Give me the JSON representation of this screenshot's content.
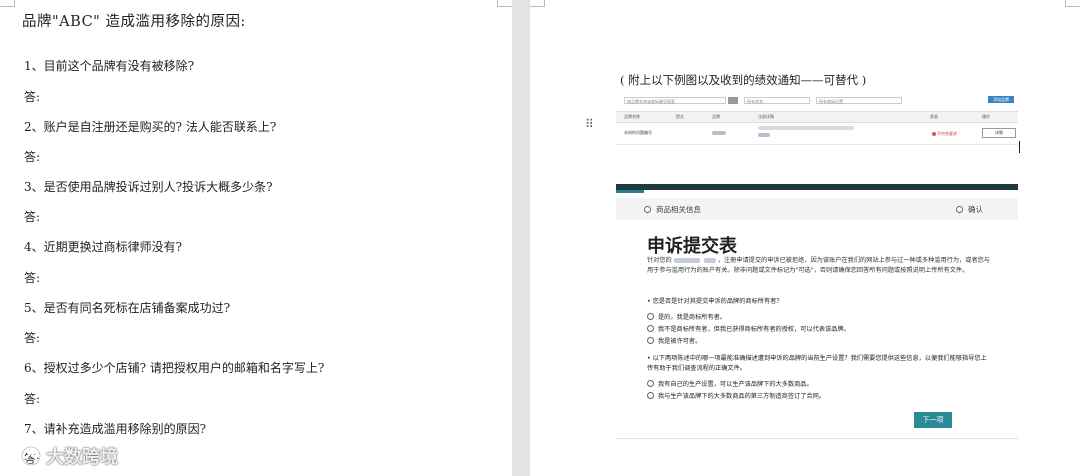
{
  "left": {
    "title": "品牌\"ABC\" 造成滥用移除的原因:",
    "items": [
      {
        "q": "1、目前这个品牌有没有被移除?",
        "a": "答:"
      },
      {
        "q": "2、账户是自注册还是购买的? 法人能否联系上?",
        "a": "答:"
      },
      {
        "q": "3、是否使用品牌投诉过别人?投诉大概多少条?",
        "a": "答:"
      },
      {
        "q": "4、近期更换过商标律师没有?",
        "a": "答:"
      },
      {
        "q": "5、是否有同名死标在店铺备案成功过?",
        "a": "答:"
      },
      {
        "q": "6、授权过多少个店铺? 请把授权用户的邮箱和名字写上?",
        "a": "答:"
      },
      {
        "q": "7、请补充造成滥用移除别的原因?",
        "a": "答:"
      }
    ]
  },
  "right": {
    "caption": "( 附上以下例图以及收到的绩效通知——可替代 )",
    "table": {
      "search_placeholder": "按品牌名称或商标编号搜索",
      "filter1": "所有状态",
      "filter2": "所有商标位置",
      "top_button": "添加品牌",
      "headers": [
        "品牌名称",
        "提交",
        "品牌",
        "注册详情",
        "状态",
        "操作"
      ],
      "row": {
        "name": "未知的问题编号",
        "status": "不符合要求",
        "action": "详细"
      }
    },
    "form": {
      "step1": "商品相关信息",
      "step2": "确认",
      "title": "申诉提交表",
      "desc_part1": "针对您的",
      "desc_part2": "，注册申请提交的申诉已被拒绝，因为该账户在我们的网站上参与过一种或多种滥用行为，或者您与用于参与滥用行为的账户有关。除非问题或文件标记为\"可选\"，否则请确保您回答所有问题或按照说明上传所有文件。",
      "q1": "• 您是否是针对其提交申诉的品牌的商标所有者？",
      "q1_options": [
        "是的，我是商标所有者。",
        "我不是商标所有者，但我已获得商标所有者的授权，可以代表该品牌。",
        "我是被许可者。"
      ],
      "q2": "• 以下两项陈述中的哪一项最能准确描述遭到申诉的品牌的当前生产设置？我们需要您提供这些信息，以便我们能够指导您上传有助于我们调查流程的正确文件。",
      "q2_options": [
        "我有自己的生产设置，可以生产该品牌下的大多数商品。",
        "我与生产该品牌下的大多数商品的第三方制造商签订了合同。"
      ],
      "next_button": "下一项"
    }
  },
  "watermark": "大数跨境",
  "colors": {
    "teal": "#2a8a96",
    "dark_bar": "#1f3a3d",
    "error": "#d9534f"
  }
}
